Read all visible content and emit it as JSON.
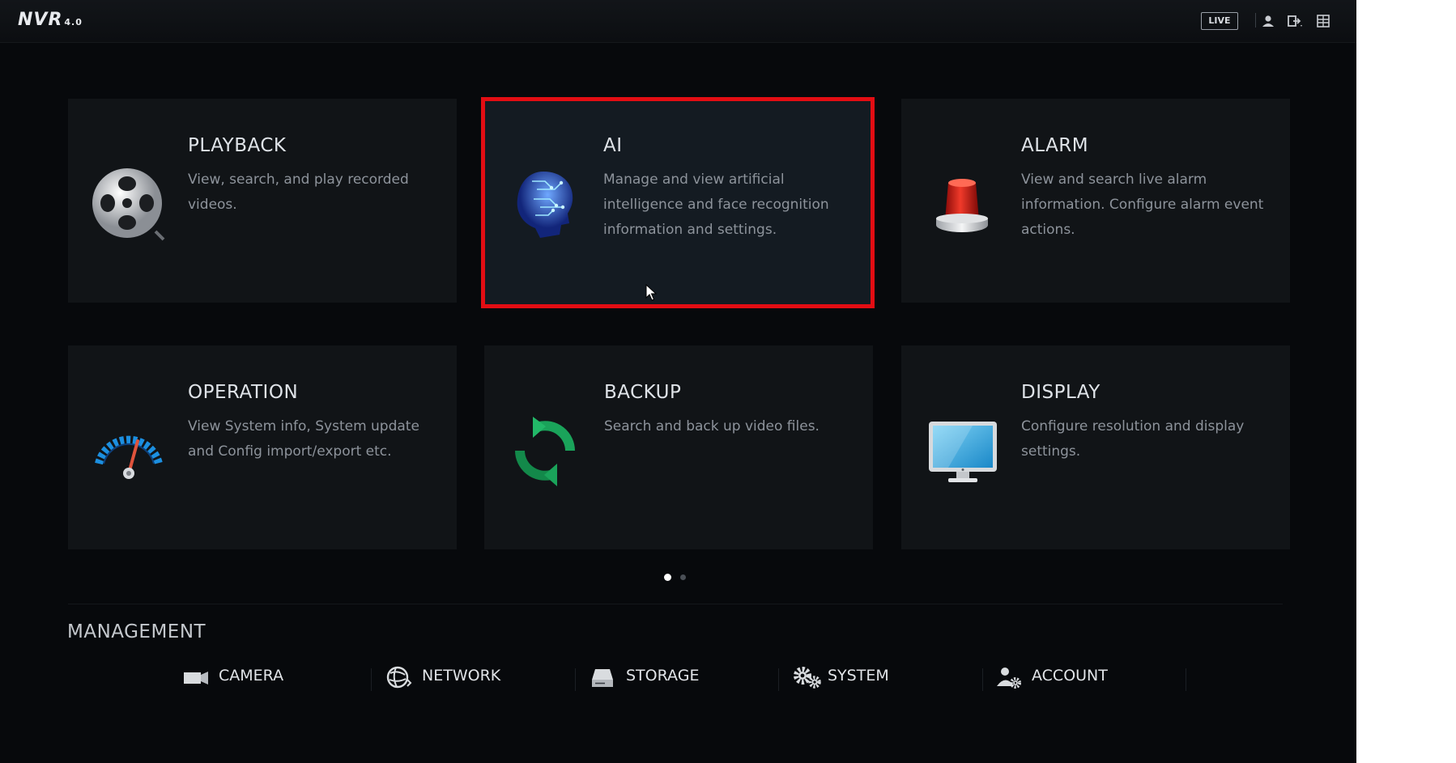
{
  "header": {
    "logo_text": "NVR",
    "logo_version": "4.0",
    "live_label": "LIVE",
    "icons": [
      "user-icon",
      "logout-icon",
      "layout-icon"
    ]
  },
  "tiles": [
    {
      "title": "PLAYBACK",
      "description": "View, search, and play recorded videos.",
      "icon": "film-reel-icon"
    },
    {
      "title": "AI",
      "description": "Manage and view artificial intelligence and face recognition information and settings.",
      "icon": "ai-brain-icon",
      "highlighted": true
    },
    {
      "title": "ALARM",
      "description": "View and search live alarm information. Configure alarm event actions.",
      "icon": "alarm-siren-icon"
    },
    {
      "title": "OPERATION",
      "description": "View System info, System update and Config import/export etc.",
      "icon": "gauge-icon"
    },
    {
      "title": "BACKUP",
      "description": "Search and back up video files.",
      "icon": "sync-arrows-icon"
    },
    {
      "title": "DISPLAY",
      "description": "Configure resolution and display settings.",
      "icon": "monitor-icon"
    }
  ],
  "pagination": {
    "total": 2,
    "active": 1
  },
  "management": {
    "title": "MANAGEMENT",
    "items": [
      {
        "label": "CAMERA",
        "icon": "camera-icon"
      },
      {
        "label": "NETWORK",
        "icon": "network-globe-icon"
      },
      {
        "label": "STORAGE",
        "icon": "storage-drive-icon"
      },
      {
        "label": "SYSTEM",
        "icon": "gears-icon"
      },
      {
        "label": "ACCOUNT",
        "icon": "account-gear-icon"
      }
    ]
  },
  "colors": {
    "background": "#07090c",
    "tile": "#111417",
    "tile_selected": "#141b22",
    "highlight_border": "#e30d13",
    "title_text": "#dfe3e8",
    "description_text": "#8d939b"
  }
}
